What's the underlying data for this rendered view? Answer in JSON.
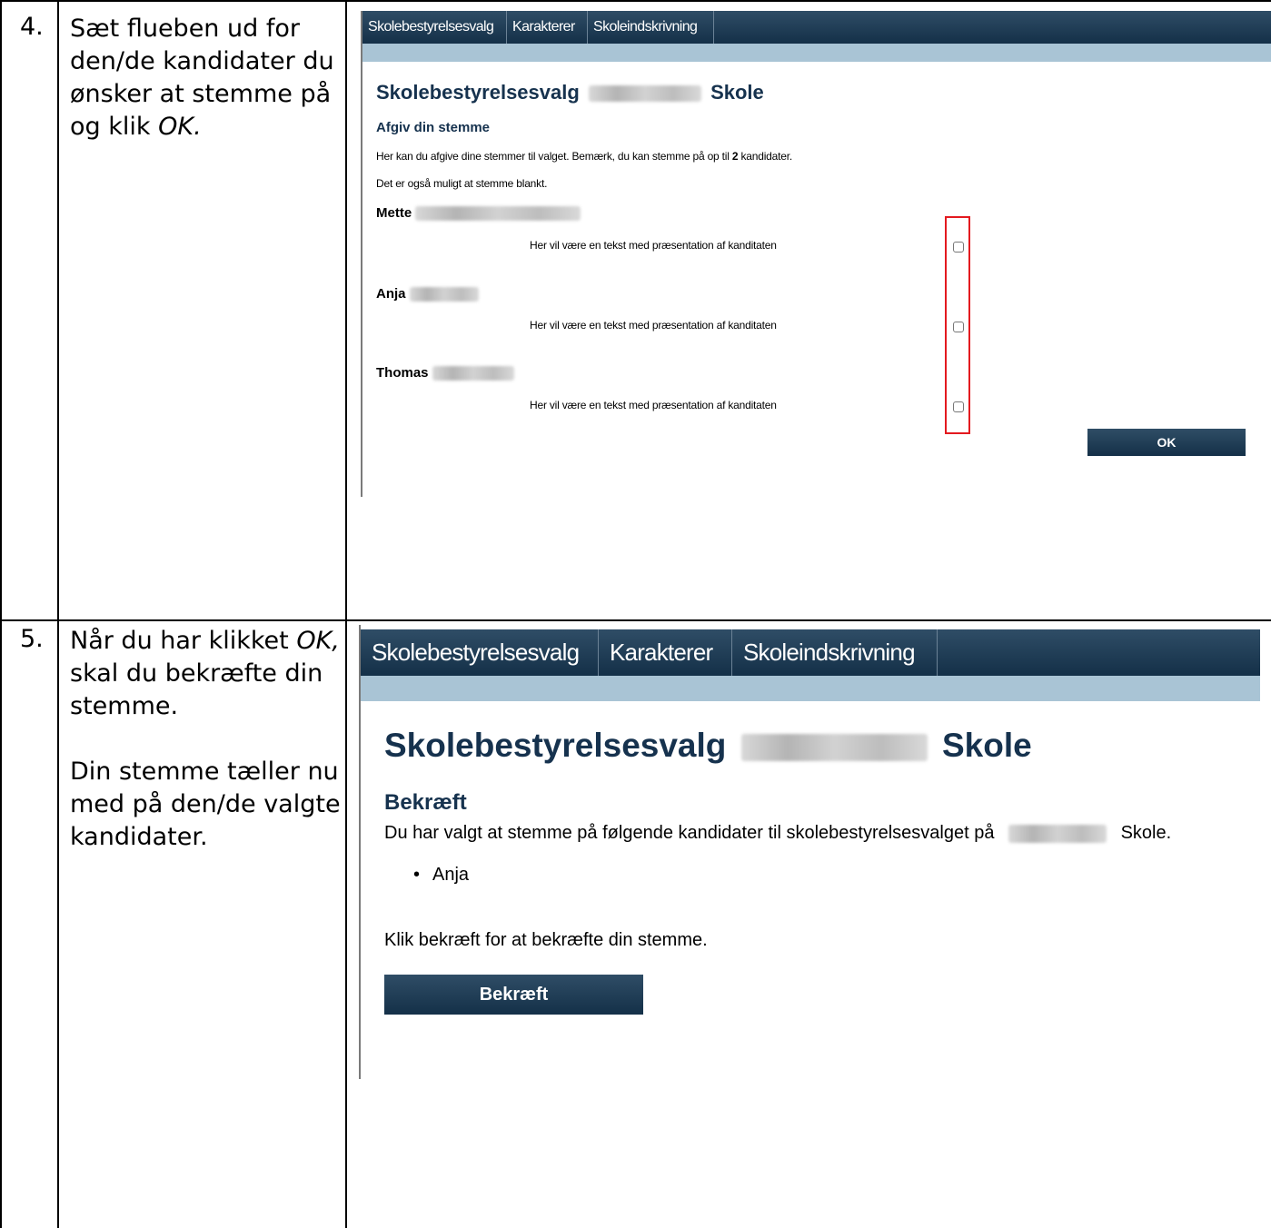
{
  "steps": [
    {
      "number": "4.",
      "instruction_parts": [
        "Sæt flueben ud for den/de kandidater du ønsker at stemme på og klik ",
        "OK."
      ],
      "screenshot": {
        "tabs": [
          "Skolebestyrelsesvalg",
          "Karakterer",
          "Skoleindskrivning"
        ],
        "title_left": "Skolebestyrelsesvalg",
        "title_right": "Skole",
        "subtitle": "Afgiv din stemme",
        "info_pre": "Her kan du afgive dine stemmer til valget. Bemærk, du kan stemme på op til ",
        "info_count": "2",
        "info_post": " kandidater.",
        "info_line2": "Det er også muligt at stemme blankt.",
        "candidates": [
          {
            "name": "Mette",
            "description": "Her vil være en tekst med præsentation af kanditaten",
            "checked": false
          },
          {
            "name": "Anja",
            "description": "Her vil være en tekst med præsentation af kanditaten",
            "checked": false
          },
          {
            "name": "Thomas",
            "description": "Her vil være en tekst med præsentation af kanditaten",
            "checked": false
          }
        ],
        "ok_label": "OK"
      }
    },
    {
      "number": "5.",
      "instruction_p1_pre": "Når du har klikket ",
      "instruction_p1_em": "OK,",
      "instruction_p1_post": " skal du bekræfte din stemme.",
      "instruction_p2": "Din stemme tæller nu med på den/de valgte kandidater.",
      "screenshot": {
        "tabs": [
          "Skolebestyrelsesvalg",
          "Karakterer",
          "Skoleindskrivning"
        ],
        "title_left": "Skolebestyrelsesvalg",
        "title_right": "Skole",
        "subtitle": "Bekræft",
        "chosen_pre": "Du har valgt at stemme på følgende kandidater til skolebestyrelsesvalget på",
        "chosen_post": "Skole.",
        "chosen_list": [
          "Anja"
        ],
        "confirm_text": "Klik bekræft for at bekræfte din stemme.",
        "confirm_label": "Bekræft"
      }
    }
  ],
  "colors": {
    "nav_bar": "#1e3a55",
    "sub_bar": "#a9c4d5",
    "heading": "#16324e",
    "highlight": "#e3191f"
  }
}
